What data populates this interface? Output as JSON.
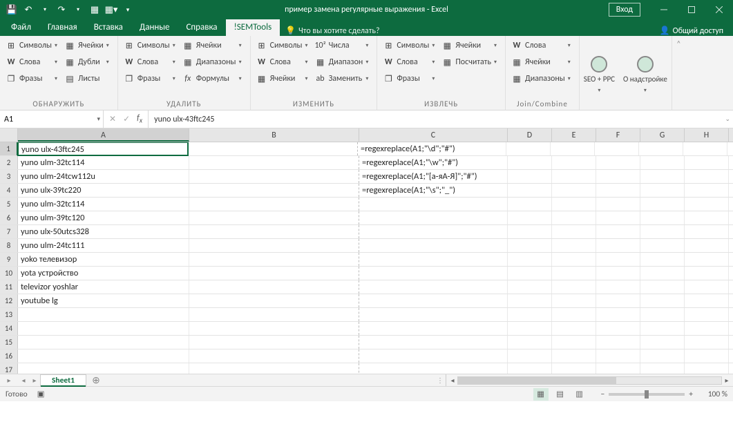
{
  "title": "пример замена регулярные выражения - Excel",
  "login": "Вход",
  "tabs": [
    "Файл",
    "Главная",
    "Вставка",
    "Данные",
    "Справка",
    "!SEMTools"
  ],
  "active_tab": 5,
  "tell_me": "Что вы хотите сделать?",
  "share": "Общий доступ",
  "ribbon": {
    "g1": {
      "label": "ОБНАРУЖИТЬ",
      "c1": [
        "Символы",
        "Слова",
        "Фразы"
      ],
      "c2": [
        "Ячейки",
        "Дубли",
        "Листы"
      ]
    },
    "g2": {
      "label": "УДАЛИТЬ",
      "c1": [
        "Символы",
        "Слова",
        "Фразы"
      ],
      "c2": [
        "Ячейки",
        "Диапазоны",
        "Формулы"
      ]
    },
    "g3": {
      "label": "ИЗМЕНИТЬ",
      "c1": [
        "Символы",
        "Слова",
        "Ячейки"
      ],
      "c2": [
        "Числа",
        "Диапазон",
        "Заменить"
      ],
      "c2_prefix": "10²"
    },
    "g4": {
      "label": "ИЗВЛЕЧЬ",
      "c1": [
        "Символы",
        "Слова",
        "Фразы"
      ],
      "c2": [
        "Ячейки",
        "Посчитать",
        ""
      ]
    },
    "g5": {
      "label": "Join/Combine",
      "c1": [
        "Слова",
        "Ячейки",
        "Диапазоны"
      ]
    },
    "big1": "SEO + PPC",
    "big2": "О надстройке"
  },
  "name_box": "A1",
  "formula": "yuno ulx-43ftc245",
  "columns": [
    "A",
    "B",
    "C",
    "D",
    "E",
    "F",
    "G",
    "H"
  ],
  "col_classes": [
    "wA",
    "wB",
    "wC",
    "wD",
    "wE",
    "wF",
    "wG",
    "wH"
  ],
  "rows": [
    {
      "n": 1,
      "A": "yuno ulx-43ftc245",
      "C": "=regexreplace(A1;\"\\d\";\"#\")"
    },
    {
      "n": 2,
      "A": "yuno ulm-32tc114",
      "C": "=regexreplace(A1;\"\\w\";\"#\")"
    },
    {
      "n": 3,
      "A": "yuno ulm-24tcw112u",
      "C": "=regexreplace(A1;\"[а-яА-Я]\";\"#\")"
    },
    {
      "n": 4,
      "A": "yuno ulx-39tc220",
      "C": "=regexreplace(A1;\"\\s\";\"_\")"
    },
    {
      "n": 5,
      "A": "yuno ulm-32tc114"
    },
    {
      "n": 6,
      "A": "yuno ulm-39tc120"
    },
    {
      "n": 7,
      "A": "yuno ulx-50utcs328"
    },
    {
      "n": 8,
      "A": "yuno ulm-24tc111"
    },
    {
      "n": 9,
      "A": "yoko телевизор"
    },
    {
      "n": 10,
      "A": "yota устройство"
    },
    {
      "n": 11,
      "A": "televizor yoshlar"
    },
    {
      "n": 12,
      "A": "youtube lg"
    },
    {
      "n": 13
    },
    {
      "n": 14
    },
    {
      "n": 15
    },
    {
      "n": 16
    },
    {
      "n": 17
    }
  ],
  "sheet_tab": "Sheet1",
  "status": "Готово",
  "zoom": "100 %"
}
